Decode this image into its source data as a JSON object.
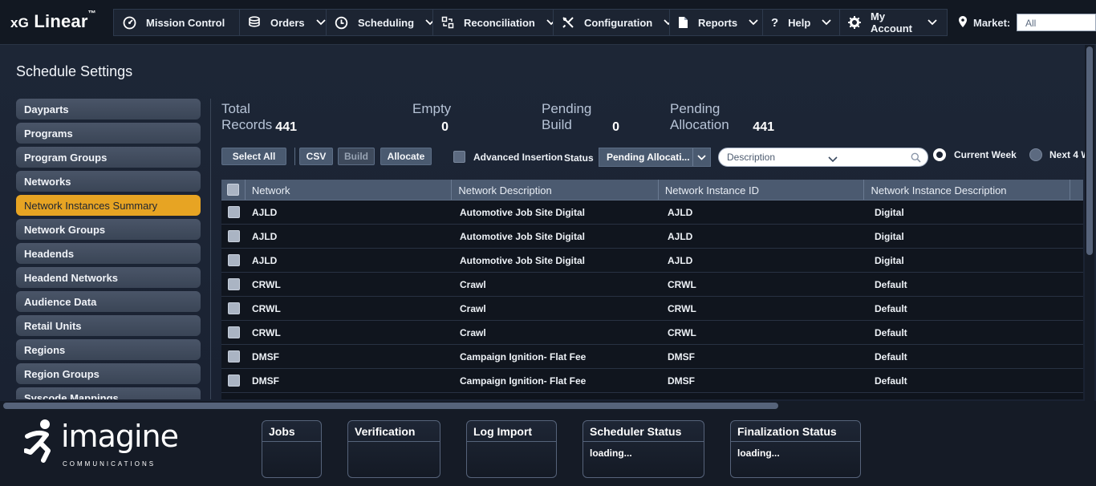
{
  "app": {
    "title_prefix": "xG",
    "title_main": "Linear",
    "title_tm": "™"
  },
  "nav": [
    {
      "label": "Mission Control",
      "icon": "gauge-icon",
      "has_menu": false
    },
    {
      "label": "Orders",
      "icon": "stack-icon",
      "has_menu": true
    },
    {
      "label": "Scheduling",
      "icon": "clock-icon",
      "has_menu": true
    },
    {
      "label": "Reconciliation",
      "icon": "reconcile-icon",
      "has_menu": true
    },
    {
      "label": "Configuration",
      "icon": "tools-icon",
      "has_menu": true
    },
    {
      "label": "Reports",
      "icon": "document-icon",
      "has_menu": true
    },
    {
      "label": "Help",
      "icon": "question-icon",
      "has_menu": true
    },
    {
      "label": "My Account",
      "icon": "gear-icon",
      "has_menu": true
    }
  ],
  "market": {
    "label": "Market:",
    "value": "All"
  },
  "page": {
    "title": "Schedule Settings"
  },
  "sidebar": {
    "items": [
      {
        "label": "Dayparts",
        "active": false
      },
      {
        "label": "Programs",
        "active": false
      },
      {
        "label": "Program Groups",
        "active": false
      },
      {
        "label": "Networks",
        "active": false
      },
      {
        "label": "Network Instances Summary",
        "active": true
      },
      {
        "label": "Network Groups",
        "active": false
      },
      {
        "label": "Headends",
        "active": false
      },
      {
        "label": "Headend Networks",
        "active": false
      },
      {
        "label": "Audience Data",
        "active": false
      },
      {
        "label": "Retail Units",
        "active": false
      },
      {
        "label": "Regions",
        "active": false
      },
      {
        "label": "Region Groups",
        "active": false
      },
      {
        "label": "Syscode Mappings",
        "active": false
      }
    ]
  },
  "stats": {
    "total": {
      "label": "Total Records",
      "value": "441"
    },
    "empty": {
      "label": "Empty",
      "value": "0"
    },
    "pending_build": {
      "label": "Pending Build",
      "value": "0"
    },
    "pending_alloc": {
      "label": "Pending Allocation",
      "value": "441"
    }
  },
  "toolbar": {
    "select_all": "Select All",
    "csv": "CSV",
    "build": "Build",
    "allocate": "Allocate",
    "advanced_insertion": "Advanced Insertion",
    "status_label": "Status",
    "status_value": "Pending Allocati...",
    "description_placeholder": "Description",
    "current_week": "Current Week",
    "next_weeks": "Next 4 W"
  },
  "table": {
    "columns": [
      "Network",
      "Network Description",
      "Network Instance ID",
      "Network Instance Description"
    ],
    "rows": [
      [
        "AJLD",
        "Automotive Job Site Digital",
        "AJLD",
        "Digital"
      ],
      [
        "AJLD",
        "Automotive Job Site Digital",
        "AJLD",
        "Digital"
      ],
      [
        "AJLD",
        "Automotive Job Site Digital",
        "AJLD",
        "Digital"
      ],
      [
        "CRWL",
        "Crawl",
        "CRWL",
        "Default"
      ],
      [
        "CRWL",
        "Crawl",
        "CRWL",
        "Default"
      ],
      [
        "CRWL",
        "Crawl",
        "CRWL",
        "Default"
      ],
      [
        "DMSF",
        "Campaign Ignition- Flat Fee",
        "DMSF",
        "Default"
      ],
      [
        "DMSF",
        "Campaign Ignition- Flat Fee",
        "DMSF",
        "Default"
      ]
    ]
  },
  "footer": {
    "brand_word": "imagine",
    "brand_sub": "COMMUNICATIONS",
    "panels": [
      {
        "title": "Jobs",
        "body": ""
      },
      {
        "title": "Verification",
        "body": ""
      },
      {
        "title": "Log Import",
        "body": ""
      },
      {
        "title": "Scheduler Status",
        "body": "loading..."
      },
      {
        "title": "Finalization Status",
        "body": "loading..."
      }
    ]
  },
  "colors": {
    "accent": "#e7a423",
    "header_bg": "#121822",
    "page_bg": "#1a2232"
  }
}
